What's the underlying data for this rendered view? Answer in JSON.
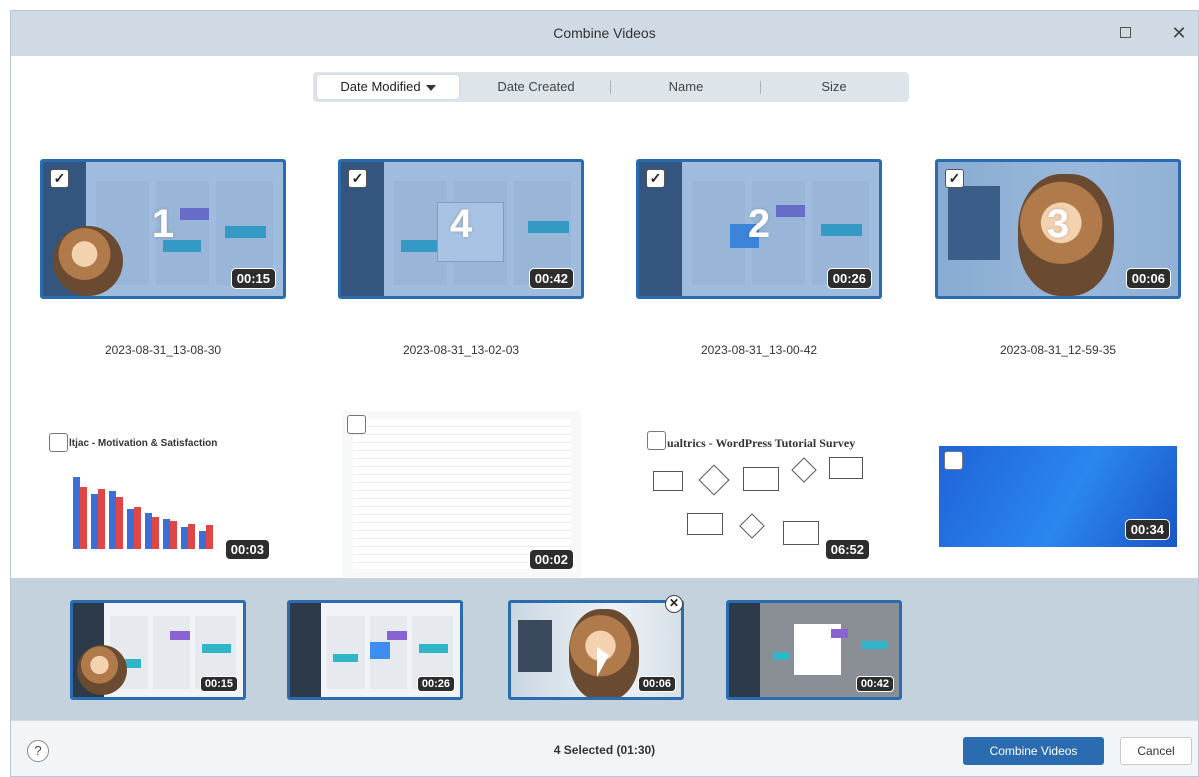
{
  "window": {
    "title": "Combine Videos",
    "close_glyph": "✕"
  },
  "sort": {
    "tabs": [
      "Date Modified",
      "Date Created",
      "Name",
      "Size"
    ],
    "active": "Date Modified"
  },
  "grid_top": [
    {
      "number": "1",
      "duration": "00:15",
      "name": "2023-08-31_13-08-30",
      "checked": true
    },
    {
      "number": "4",
      "duration": "00:42",
      "name": "2023-08-31_13-02-03",
      "checked": true
    },
    {
      "number": "2",
      "duration": "00:26",
      "name": "2023-08-31_13-00-42",
      "checked": true
    },
    {
      "number": "3",
      "duration": "00:06",
      "name": "2023-08-31_12-59-35",
      "checked": true
    }
  ],
  "grid_bottom": [
    {
      "duration": "00:03",
      "caption": "ltjac - Motivation & Satisfaction",
      "checked": false
    },
    {
      "duration": "00:02",
      "checked": false
    },
    {
      "duration": "06:52",
      "caption": "ualtrics - WordPress Tutorial Survey",
      "checked": false
    },
    {
      "duration": "00:34",
      "checked": false
    }
  ],
  "strip": [
    {
      "duration": "00:15"
    },
    {
      "duration": "00:26"
    },
    {
      "duration": "00:06"
    },
    {
      "duration": "00:42"
    }
  ],
  "footer": {
    "help": "?",
    "status": "4 Selected (01:30)",
    "combine_label": "Combine Videos",
    "cancel_label": "Cancel"
  },
  "colors": {
    "accent": "#2b6cb0",
    "titlebar": "#cfdae4",
    "strip_bg": "#c4d2de",
    "bar_blue": "#3b6fd6",
    "bar_red": "#e04646"
  }
}
